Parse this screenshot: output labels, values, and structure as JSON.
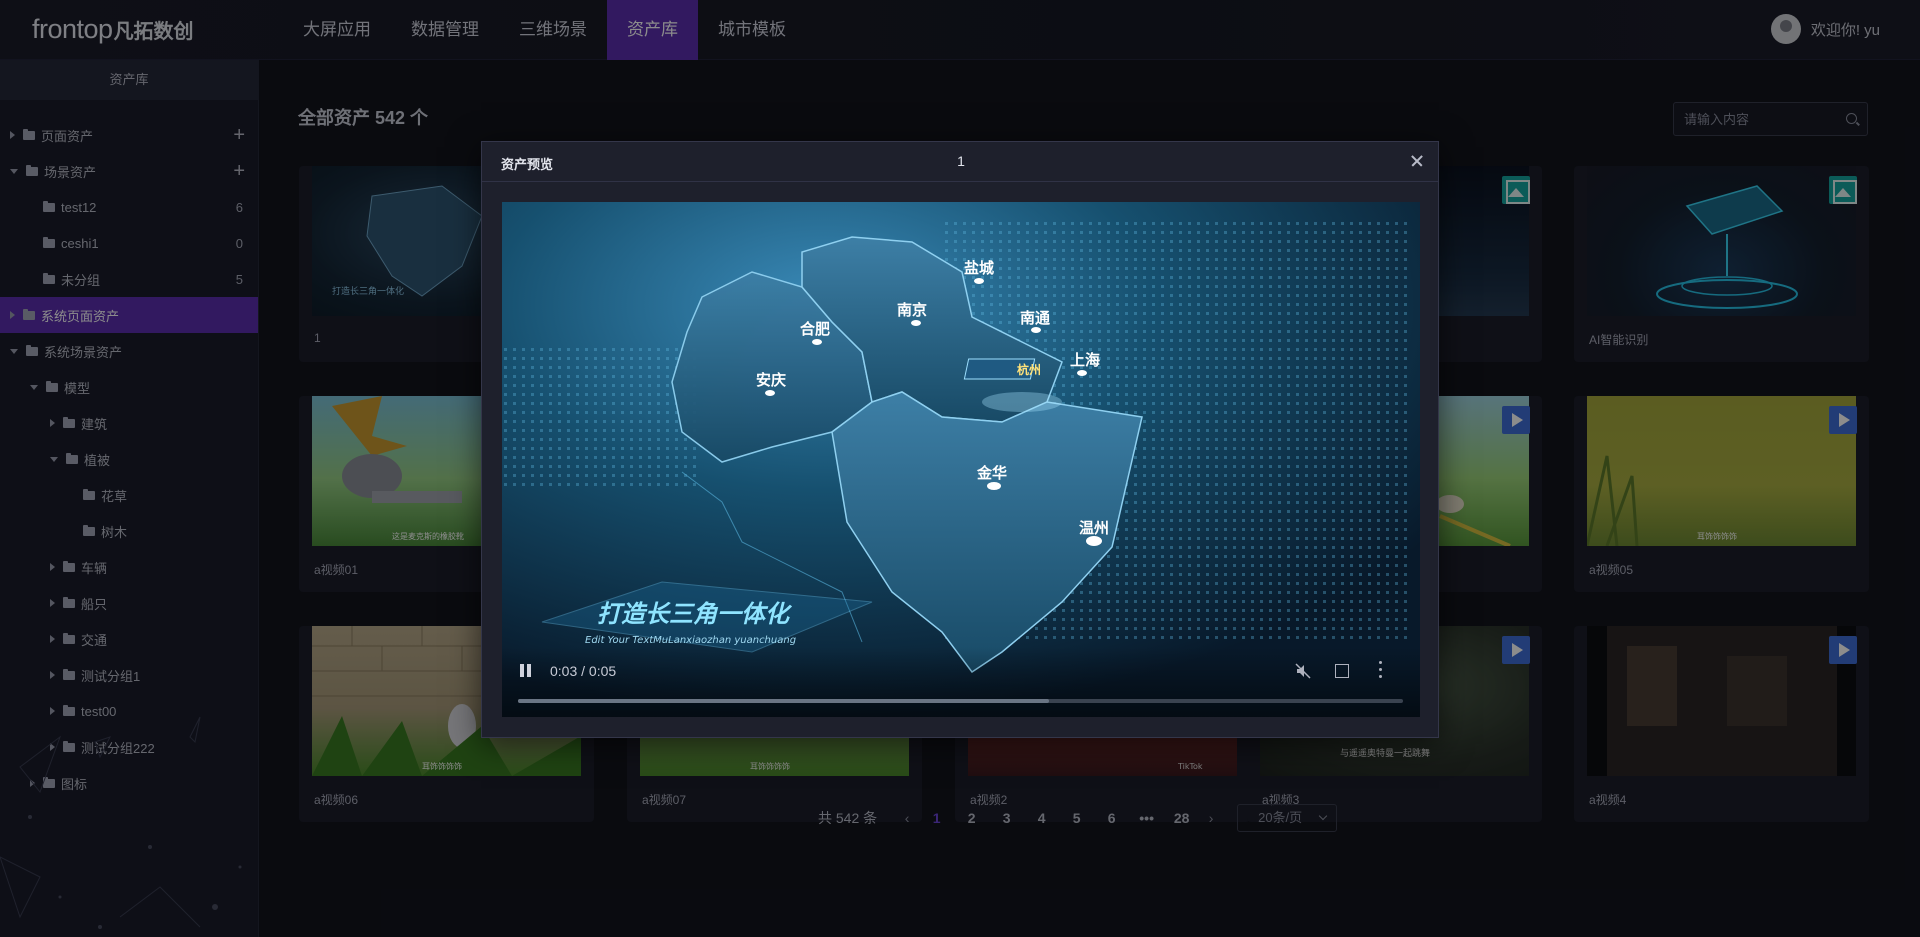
{
  "header": {
    "logo_en": "frontop",
    "logo_cn": "凡拓数创",
    "nav": [
      "大屏应用",
      "数据管理",
      "三维场景",
      "资产库",
      "城市模板"
    ],
    "active_nav": "资产库",
    "welcome": "欢迎你! yu"
  },
  "sidebar": {
    "title": "资产库",
    "items": [
      {
        "label": "页面资产",
        "level": 0,
        "state": "collapsed",
        "plus": true
      },
      {
        "label": "场景资产",
        "level": 0,
        "state": "expanded",
        "plus": true
      },
      {
        "label": "test12",
        "level": 1,
        "state": "leaf",
        "count": "6"
      },
      {
        "label": "ceshi1",
        "level": 1,
        "state": "leaf",
        "count": "0"
      },
      {
        "label": "未分组",
        "level": 1,
        "state": "leaf",
        "count": "5"
      },
      {
        "label": "系统页面资产",
        "level": 0,
        "state": "collapsed",
        "active": true
      },
      {
        "label": "系统场景资产",
        "level": 0,
        "state": "expanded"
      },
      {
        "label": "模型",
        "level": 1,
        "state": "expanded"
      },
      {
        "label": "建筑",
        "level": 2,
        "state": "collapsed"
      },
      {
        "label": "植被",
        "level": 2,
        "state": "expanded"
      },
      {
        "label": "花草",
        "level": 3,
        "state": "leaf"
      },
      {
        "label": "树木",
        "level": 3,
        "state": "leaf"
      },
      {
        "label": "车辆",
        "level": 2,
        "state": "collapsed"
      },
      {
        "label": "船只",
        "level": 2,
        "state": "collapsed"
      },
      {
        "label": "交通",
        "level": 2,
        "state": "collapsed"
      },
      {
        "label": "测试分组1",
        "level": 2,
        "state": "collapsed"
      },
      {
        "label": "test00",
        "level": 2,
        "state": "collapsed"
      },
      {
        "label": "测试分组222",
        "level": 2,
        "state": "collapsed"
      },
      {
        "label": "图标",
        "level": 1,
        "state": "collapsed"
      }
    ]
  },
  "main": {
    "title": "全部资产 542 个",
    "search_placeholder": "请输入内容",
    "cards": [
      {
        "name": "1",
        "type": "map"
      },
      {
        "name": "",
        "type": "image"
      },
      {
        "name": "AI智能识别",
        "type": "image"
      },
      {
        "name": "a视频01",
        "type": "video"
      },
      {
        "name": "",
        "type": "video"
      },
      {
        "name": "a视频05",
        "type": "video"
      },
      {
        "name": "a视频06",
        "type": "video"
      },
      {
        "name": "a视频07",
        "type": "video"
      },
      {
        "name": "a视频2",
        "type": "video"
      },
      {
        "name": "a视频3",
        "type": "video"
      },
      {
        "name": "a视频4",
        "type": "video"
      }
    ],
    "thumb_captions": {
      "card1_subtitle": "这是麦克斯的橡胶靴",
      "card6_caption": "耳饰饰饰饰",
      "card7_caption": "耳饰饰饰饰",
      "card8_caption": "耳饰饰饰饰",
      "card9_caption": "TikTok",
      "card10_caption": "与遥遥奥特曼一起跳舞"
    }
  },
  "pagination": {
    "total": "共 542 条",
    "pages": [
      "1",
      "2",
      "3",
      "4",
      "5",
      "6",
      "•••",
      "28"
    ],
    "current": "1",
    "page_size": "20条/页"
  },
  "modal": {
    "title": "资产预览",
    "asset_name": "1",
    "video_time": "0:03 / 0:05",
    "progress": 0.6,
    "map_cities": [
      "盐城",
      "南京",
      "合肥",
      "南通",
      "上海",
      "杭州",
      "安庆",
      "金华",
      "温州"
    ],
    "banner_title": "打造长三角一体化",
    "banner_sub": "Edit Your TextMuLanxiaozhan yuanchuang"
  },
  "colors": {
    "accent": "#5b2fb0",
    "page_active": "#6b45d8",
    "image_badge": "#15a6a0",
    "video_badge": "#3e6ed8"
  }
}
